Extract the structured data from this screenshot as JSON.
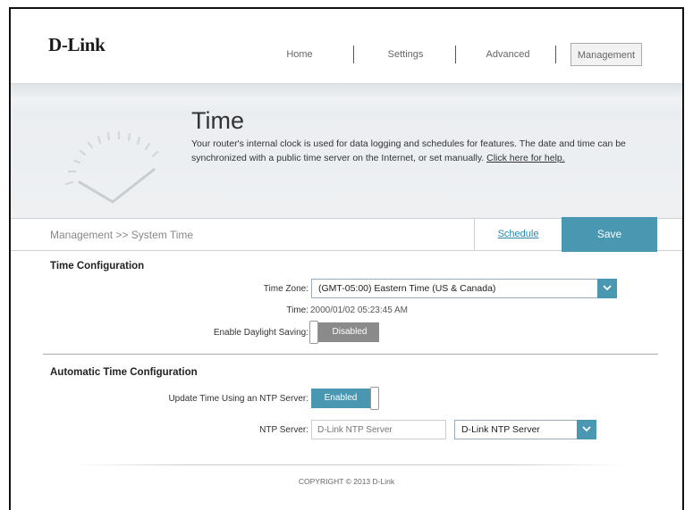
{
  "header": {
    "logo": "D-Link",
    "nav": [
      {
        "label": "Home"
      },
      {
        "label": "Settings"
      },
      {
        "label": "Advanced"
      },
      {
        "label": "Management",
        "active": true
      }
    ]
  },
  "banner": {
    "title": "Time",
    "description": "Your router's internal clock is used for data logging and schedules for features. The date and time can be synchronized with a public time server on the Internet, or set manually. ",
    "help_link": "Click here for help."
  },
  "breadcrumb": {
    "path": "Management >> System Time",
    "schedule_label": "Schedule",
    "save_label": "Save"
  },
  "time_config": {
    "title": "Time Configuration",
    "timezone_label": "Time Zone:",
    "timezone_value": "(GMT-05:00) Eastern Time (US & Canada)",
    "time_label": "Time:",
    "time_value": "2000/01/02 05:23:45 AM",
    "dst_label": "Enable Daylight Saving:",
    "dst_value": "Disabled"
  },
  "auto_time": {
    "title": "Automatic Time Configuration",
    "ntp_update_label": "Update Time Using an NTP Server:",
    "ntp_update_value": "Enabled",
    "ntp_server_label": "NTP Server:",
    "ntp_server_placeholder": "D-Link NTP Server",
    "ntp_server_select": "D-Link NTP Server"
  },
  "footer": {
    "copyright": "COPYRIGHT © 2013 D-Link"
  },
  "colors": {
    "accent": "#4a97b1",
    "disabled_gray": "#8a8a8a"
  },
  "icons": {
    "dropdown": "chevron-down-icon",
    "clock": "clock-icon"
  }
}
